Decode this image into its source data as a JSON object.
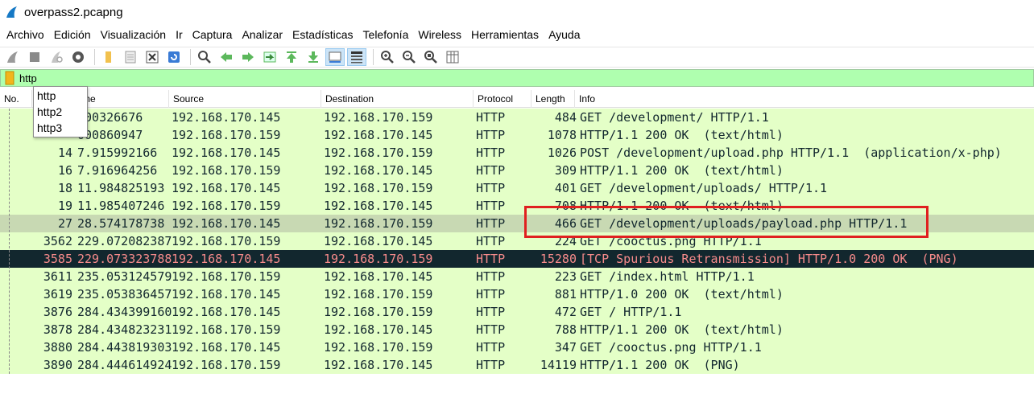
{
  "window": {
    "title": "overpass2.pcapng"
  },
  "menu": [
    "Archivo",
    "Edición",
    "Visualización",
    "Ir",
    "Captura",
    "Analizar",
    "Estadísticas",
    "Telefonía",
    "Wireless",
    "Herramientas",
    "Ayuda"
  ],
  "filter": {
    "value": "http"
  },
  "autocomplete": [
    "http",
    "http2",
    "http3"
  ],
  "columns": {
    "no": "No.",
    "time": "me",
    "source": "Source",
    "destination": "Destination",
    "protocol": "Protocol",
    "length": "Length",
    "info": "Info"
  },
  "packets": [
    {
      "no": "",
      "time": "000326676",
      "source": "192.168.170.145",
      "destination": "192.168.170.159",
      "protocol": "HTTP",
      "length": "484",
      "info": "GET /development/ HTTP/1.1"
    },
    {
      "no": "",
      "time": "000860947",
      "source": "192.168.170.159",
      "destination": "192.168.170.145",
      "protocol": "HTTP",
      "length": "1078",
      "info": "HTTP/1.1 200 OK  (text/html)"
    },
    {
      "no": "14",
      "time": "7.915992166",
      "source": "192.168.170.145",
      "destination": "192.168.170.159",
      "protocol": "HTTP",
      "length": "1026",
      "info": "POST /development/upload.php HTTP/1.1  (application/x-php)"
    },
    {
      "no": "16",
      "time": "7.916964256",
      "source": "192.168.170.159",
      "destination": "192.168.170.145",
      "protocol": "HTTP",
      "length": "309",
      "info": "HTTP/1.1 200 OK  (text/html)"
    },
    {
      "no": "18",
      "time": "11.984825193",
      "source": "192.168.170.145",
      "destination": "192.168.170.159",
      "protocol": "HTTP",
      "length": "401",
      "info": "GET /development/uploads/ HTTP/1.1"
    },
    {
      "no": "19",
      "time": "11.985407246",
      "source": "192.168.170.159",
      "destination": "192.168.170.145",
      "protocol": "HTTP",
      "length": "708",
      "info": "HTTP/1.1 200 OK  (text/html)"
    },
    {
      "no": "27",
      "time": "28.574178738",
      "source": "192.168.170.145",
      "destination": "192.168.170.159",
      "protocol": "HTTP",
      "length": "466",
      "info": "GET /development/uploads/payload.php HTTP/1.1"
    },
    {
      "no": "3562",
      "time": "229.072082387",
      "source": "192.168.170.159",
      "destination": "192.168.170.145",
      "protocol": "HTTP",
      "length": "224",
      "info": "GET /cooctus.png HTTP/1.1"
    },
    {
      "no": "3585",
      "time": "229.073323788",
      "source": "192.168.170.145",
      "destination": "192.168.170.159",
      "protocol": "HTTP",
      "length": "15280",
      "info": "[TCP Spurious Retransmission] HTTP/1.0 200 OK  (PNG)"
    },
    {
      "no": "3611",
      "time": "235.053124579",
      "source": "192.168.170.159",
      "destination": "192.168.170.145",
      "protocol": "HTTP",
      "length": "223",
      "info": "GET /index.html HTTP/1.1"
    },
    {
      "no": "3619",
      "time": "235.053836457",
      "source": "192.168.170.145",
      "destination": "192.168.170.159",
      "protocol": "HTTP",
      "length": "881",
      "info": "HTTP/1.0 200 OK  (text/html)"
    },
    {
      "no": "3876",
      "time": "284.434399160",
      "source": "192.168.170.145",
      "destination": "192.168.170.159",
      "protocol": "HTTP",
      "length": "472",
      "info": "GET / HTTP/1.1"
    },
    {
      "no": "3878",
      "time": "284.434823231",
      "source": "192.168.170.159",
      "destination": "192.168.170.145",
      "protocol": "HTTP",
      "length": "788",
      "info": "HTTP/1.1 200 OK  (text/html)"
    },
    {
      "no": "3880",
      "time": "284.443819303",
      "source": "192.168.170.145",
      "destination": "192.168.170.159",
      "protocol": "HTTP",
      "length": "347",
      "info": "GET /cooctus.png HTTP/1.1"
    },
    {
      "no": "3890",
      "time": "284.444614924",
      "source": "192.168.170.159",
      "destination": "192.168.170.145",
      "protocol": "HTTP",
      "length": "14119",
      "info": "HTTP/1.1 200 OK  (PNG)"
    }
  ],
  "colors": {
    "row_bg": "#e4ffc7",
    "row_selected": "#c8d9b3",
    "row_dark_bg": "#12272e",
    "row_dark_text": "#f78b8b",
    "filter_bg": "#afffaf",
    "highlight": "#e02020"
  }
}
